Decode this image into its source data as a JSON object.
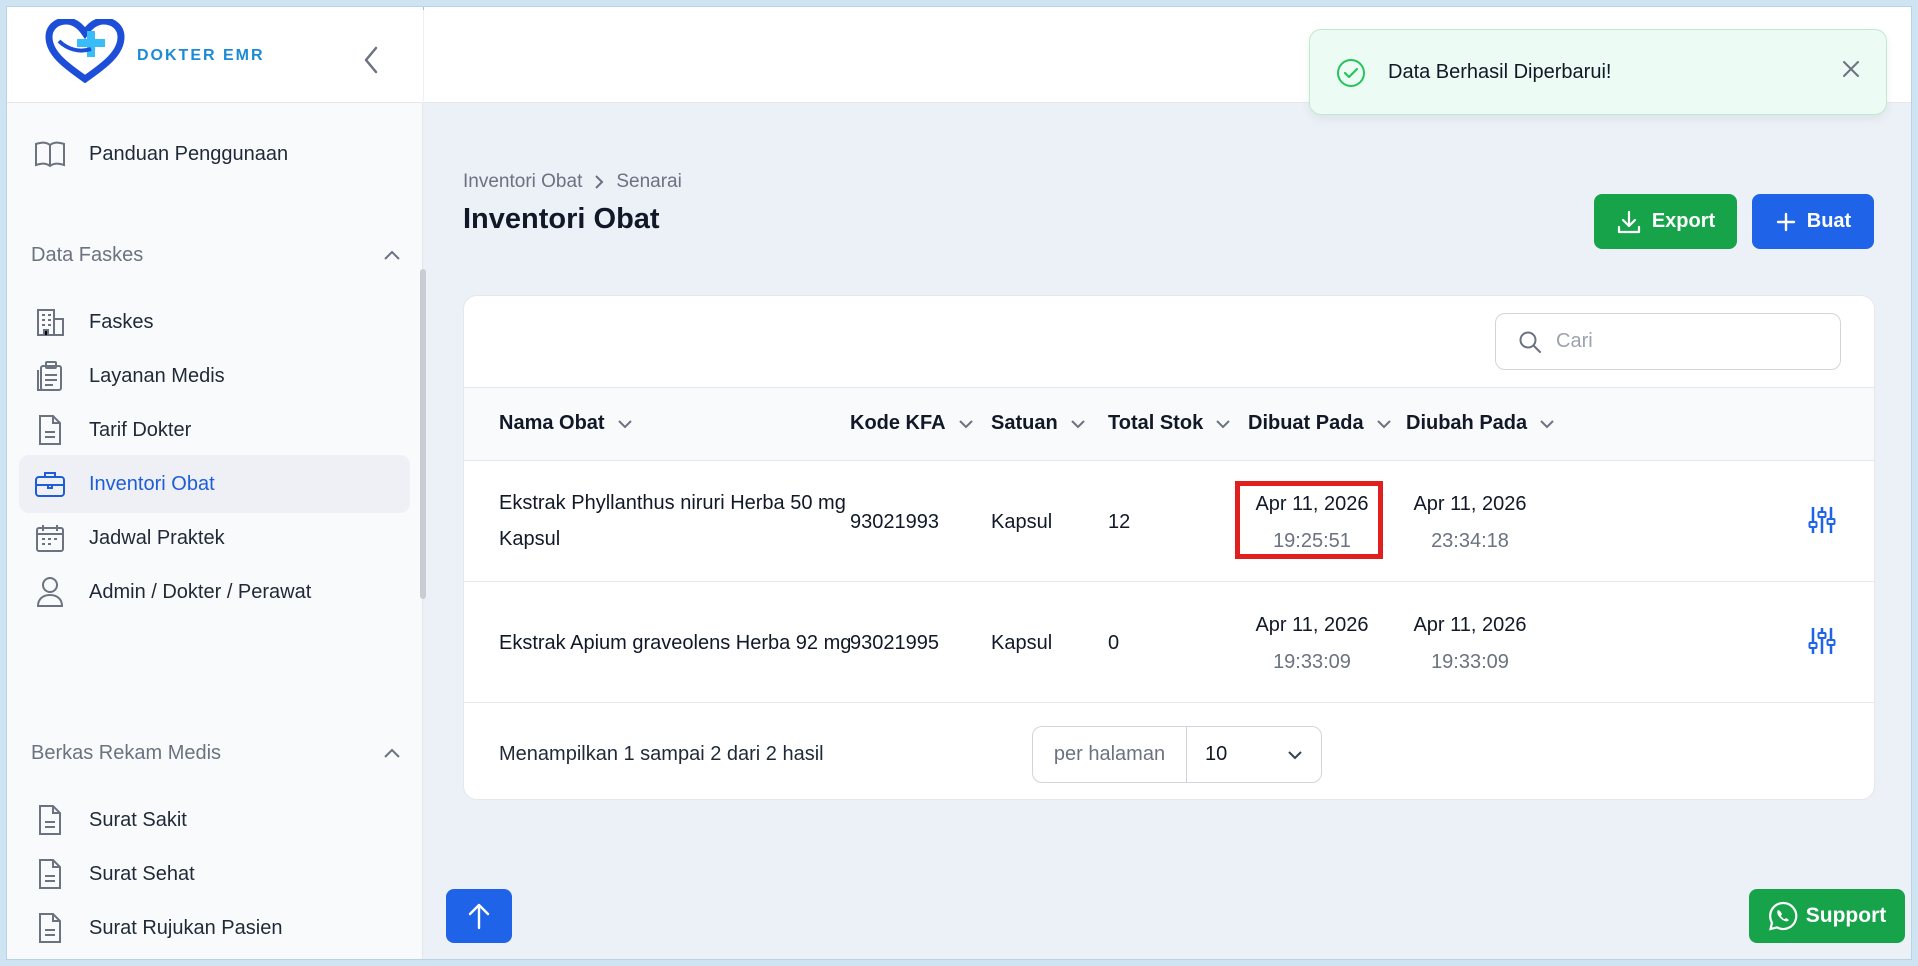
{
  "brand": {
    "name": "DOKTER EMR"
  },
  "sidebar": {
    "top_item": {
      "label": "Panduan Penggunaan",
      "icon": "book-icon"
    },
    "groups": [
      {
        "label": "Data Faskes",
        "items": [
          {
            "label": "Faskes",
            "icon": "building-icon"
          },
          {
            "label": "Layanan Medis",
            "icon": "clipboard-icon"
          },
          {
            "label": "Tarif Dokter",
            "icon": "document-icon"
          },
          {
            "label": "Inventori Obat",
            "icon": "briefcase-icon",
            "active": true
          },
          {
            "label": "Jadwal Praktek",
            "icon": "calendar-icon"
          },
          {
            "label": "Admin / Dokter / Perawat",
            "icon": "user-icon"
          }
        ]
      },
      {
        "label": "Berkas Rekam Medis",
        "items": [
          {
            "label": "Surat Sakit",
            "icon": "document-icon"
          },
          {
            "label": "Surat Sehat",
            "icon": "document-icon"
          },
          {
            "label": "Surat Rujukan Pasien",
            "icon": "document-icon"
          }
        ]
      }
    ]
  },
  "toast": {
    "message": "Data Berhasil Diperbarui!",
    "status_color": "#22c55e"
  },
  "page": {
    "breadcrumb": [
      "Inventori Obat",
      "Senarai"
    ],
    "title": "Inventori Obat",
    "export_label": "Export",
    "create_label": "Buat"
  },
  "table": {
    "search_placeholder": "Cari",
    "columns": [
      "Nama Obat",
      "Kode KFA",
      "Satuan",
      "Total Stok",
      "Dibuat Pada",
      "Diubah Pada"
    ],
    "rows": [
      {
        "name": "Ekstrak Phyllanthus niruri Herba 50 mg Kapsul",
        "code": "93021993",
        "unit": "Kapsul",
        "stock": "12",
        "created_date": "Apr 11, 2026",
        "created_time": "19:25:51",
        "updated_date": "Apr 11, 2026",
        "updated_time": "23:34:18"
      },
      {
        "name": "Ekstrak Apium graveolens Herba 92 mg",
        "code": "93021995",
        "unit": "Kapsul",
        "stock": "0",
        "created_date": "Apr 11, 2026",
        "created_time": "19:33:09",
        "updated_date": "Apr 11, 2026",
        "updated_time": "19:33:09"
      }
    ],
    "footer_text": "Menampilkan 1 sampai 2 dari 2 hasil",
    "per_page_label": "per halaman",
    "per_page_value": "10"
  },
  "support_label": "Support",
  "colors": {
    "primary": "#1f63e9",
    "success": "#16a34a",
    "highlight": "#e01f1f"
  }
}
